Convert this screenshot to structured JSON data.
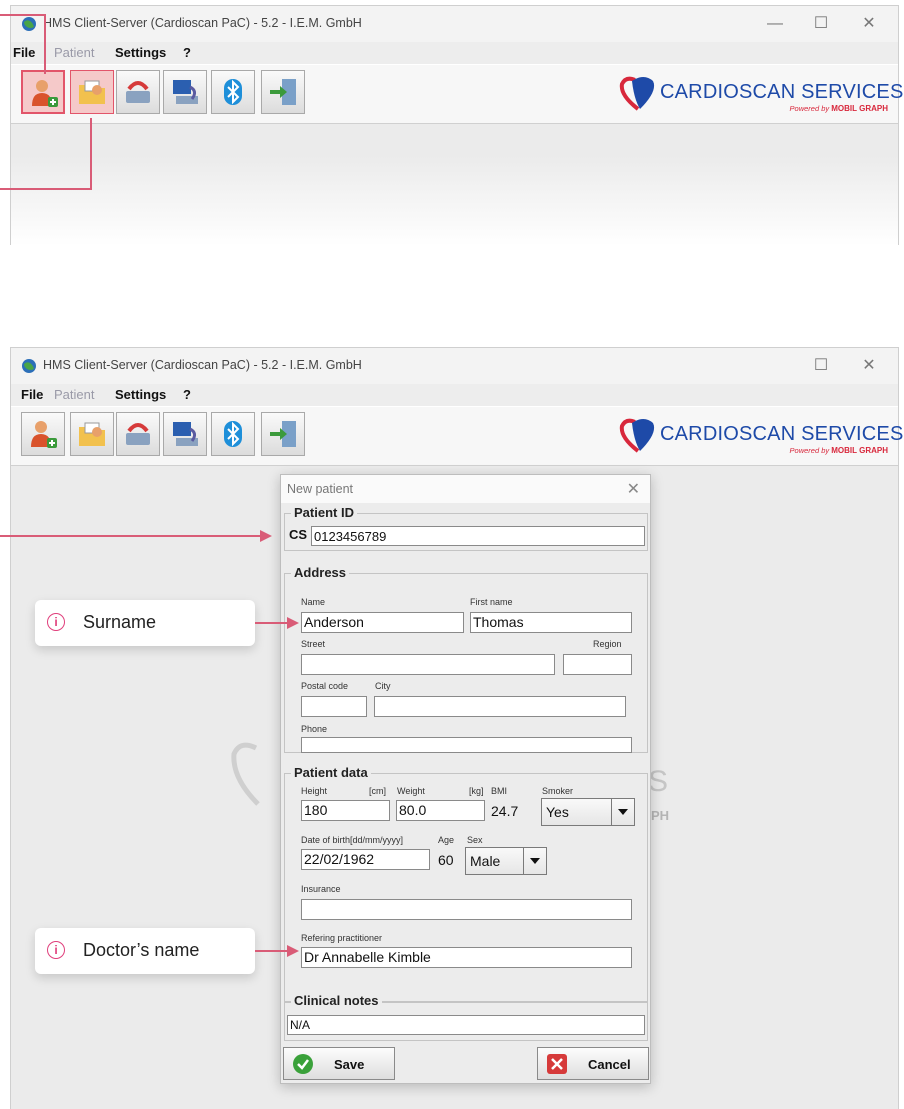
{
  "app": {
    "title": "HMS Client-Server (Cardioscan PaC) - 5.2 - I.E.M. GmbH",
    "window_controls": {
      "minimize": "—",
      "maximize": "☐",
      "close": "✕"
    },
    "menu": {
      "file": "File",
      "patient": "Patient",
      "settings": "Settings",
      "help": "?"
    },
    "toolbar": [
      "new-patient-icon",
      "open-folder-icon",
      "transfer-icon",
      "computer-sync-icon",
      "bluetooth-icon",
      "exit-door-icon"
    ],
    "logo": {
      "brand": "CARDIOSCAN SERVICES",
      "powered_prefix": "Powered by",
      "powered_brand": "MOBIL GRAPH"
    }
  },
  "watermark": "S",
  "watermark2": "PH",
  "dialog": {
    "title": "New patient",
    "close": "✕",
    "patient_id_legend": "Patient ID",
    "id_prefix": "CS",
    "patient_id": "0123456789",
    "address_legend": "Address",
    "name_label": "Name",
    "name_value": "Anderson",
    "first_name_label": "First name",
    "first_name_value": "Thomas",
    "street_label": "Street",
    "street_value": "",
    "region_label": "Region",
    "region_value": "",
    "postal_code_label": "Postal code",
    "postal_code_value": "",
    "city_label": "City",
    "city_value": "",
    "phone_label": "Phone",
    "phone_value": "",
    "patient_data_legend": "Patient data",
    "height_label": "Height",
    "height_unit": "[cm]",
    "height_value": "180",
    "weight_label": "Weight",
    "weight_unit": "[kg]",
    "weight_value": "80.0",
    "bmi_label": "BMI",
    "bmi_value": "24.7",
    "smoker_label": "Smoker",
    "smoker_value": "Yes",
    "dob_label": "Date of birth[dd/mm/yyyy]",
    "dob_value": "22/02/1962",
    "age_label": "Age",
    "age_value": "60",
    "sex_label": "Sex",
    "sex_value": "Male",
    "insurance_label": "Insurance",
    "insurance_value": "",
    "referring_label": "Refering practitioner",
    "referring_value": "Dr Annabelle Kimble",
    "clinical_notes_legend": "Clinical notes",
    "clinical_notes_value": "N/A",
    "save_label": "Save",
    "cancel_label": "Cancel"
  },
  "callouts": {
    "surname": "Surname",
    "doctor": "Doctor’s name",
    "info_glyph": "i"
  },
  "colors": {
    "accent": "#d95c77",
    "brand_blue": "#1e4aa8",
    "brand_red": "#d8283c"
  }
}
